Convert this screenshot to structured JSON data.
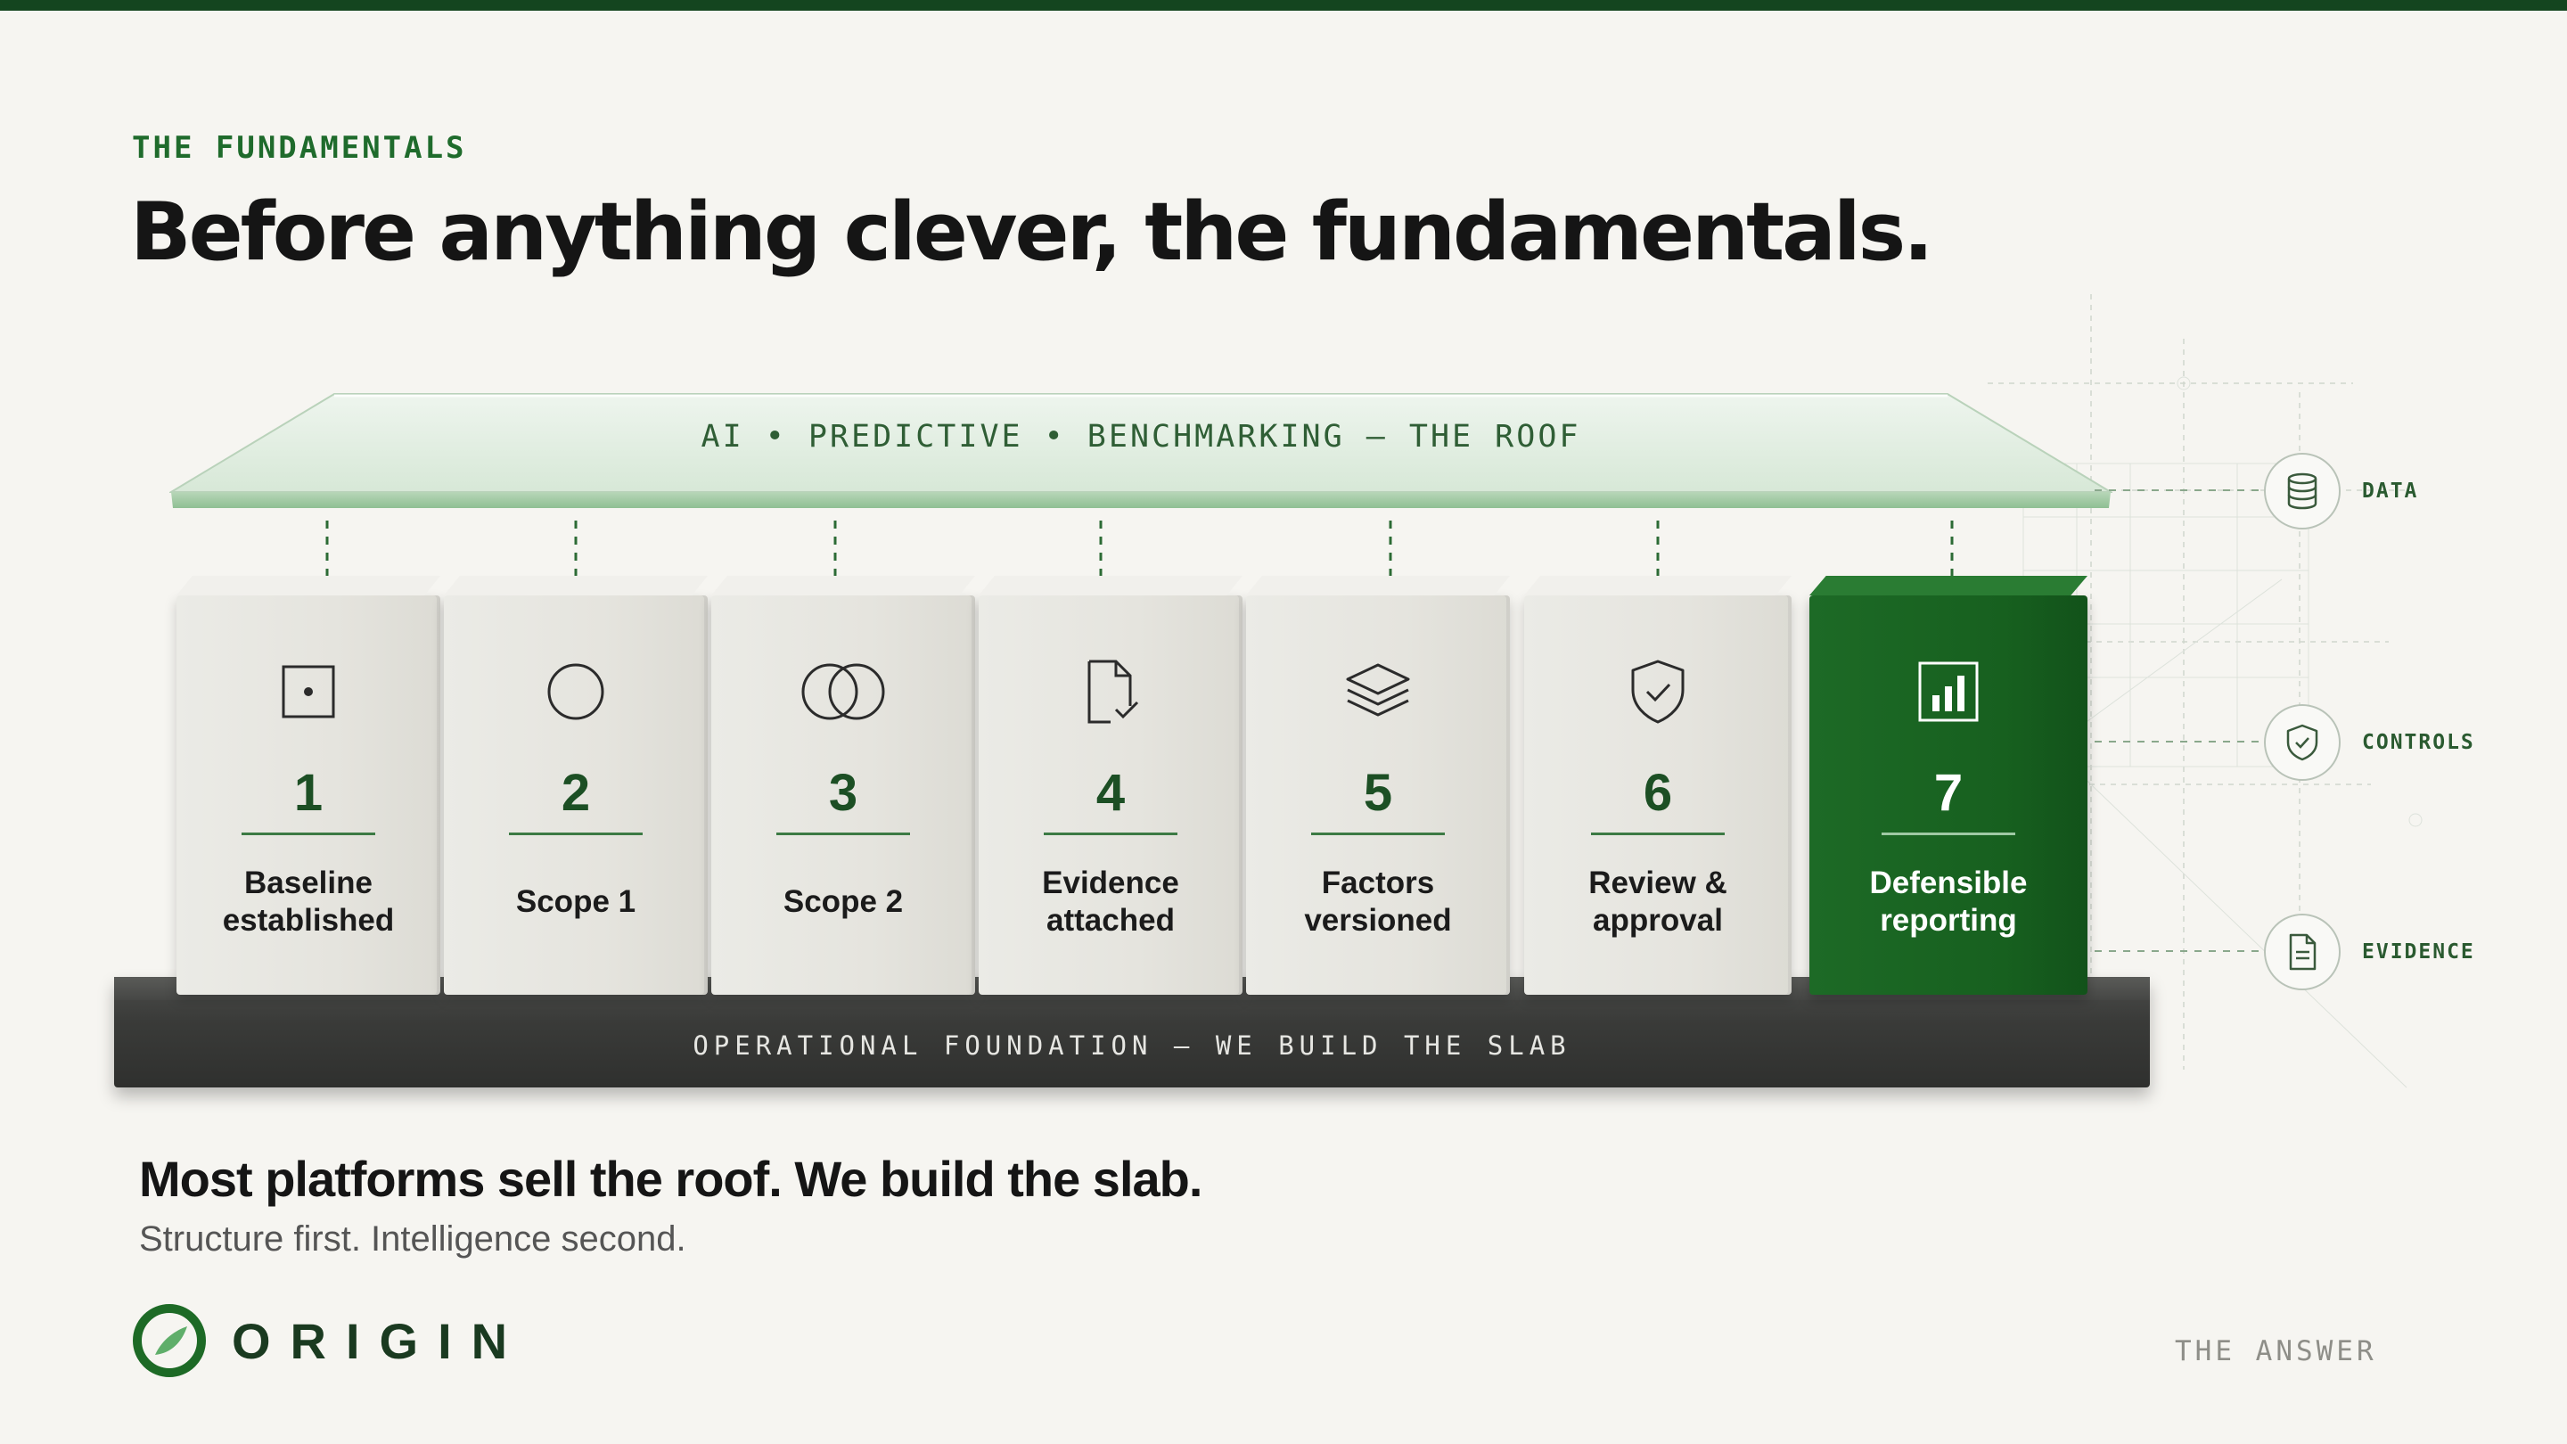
{
  "eyebrow": "THE FUNDAMENTALS",
  "headline": "Before anything clever, the fundamentals.",
  "roof": {
    "label": "AI  •  PREDICTIVE  •  BENCHMARKING  —  THE ROOF"
  },
  "blocks": [
    {
      "number": "1",
      "label": "Baseline\nestablished",
      "icon": "square-dot-icon"
    },
    {
      "number": "2",
      "label": "Scope 1",
      "icon": "circle-icon"
    },
    {
      "number": "3",
      "label": "Scope 2",
      "icon": "overlapping-circles-icon"
    },
    {
      "number": "4",
      "label": "Evidence\nattached",
      "icon": "document-check-icon"
    },
    {
      "number": "5",
      "label": "Factors\nversioned",
      "icon": "layers-icon"
    },
    {
      "number": "6",
      "label": "Review &\napproval",
      "icon": "shield-check-icon"
    },
    {
      "number": "7",
      "label": "Defensible\nreporting",
      "icon": "bar-chart-icon",
      "highlight": true
    }
  ],
  "slab": {
    "label": "OPERATIONAL FOUNDATION  —  WE BUILD THE SLAB"
  },
  "side": [
    {
      "label": "DATA",
      "icon": "database-icon"
    },
    {
      "label": "CONTROLS",
      "icon": "shield-check-icon"
    },
    {
      "label": "EVIDENCE",
      "icon": "document-icon"
    }
  ],
  "tagline": "Most platforms sell the roof. We build the slab.",
  "subline": "Structure first. Intelligence second.",
  "logo": {
    "text": "ORIGIN"
  },
  "footer": "THE ANSWER",
  "colors": {
    "brand_green": "#1d6a26",
    "dark_green": "#14451f",
    "slab": "#3a3b39",
    "background": "#f6f5f1"
  }
}
